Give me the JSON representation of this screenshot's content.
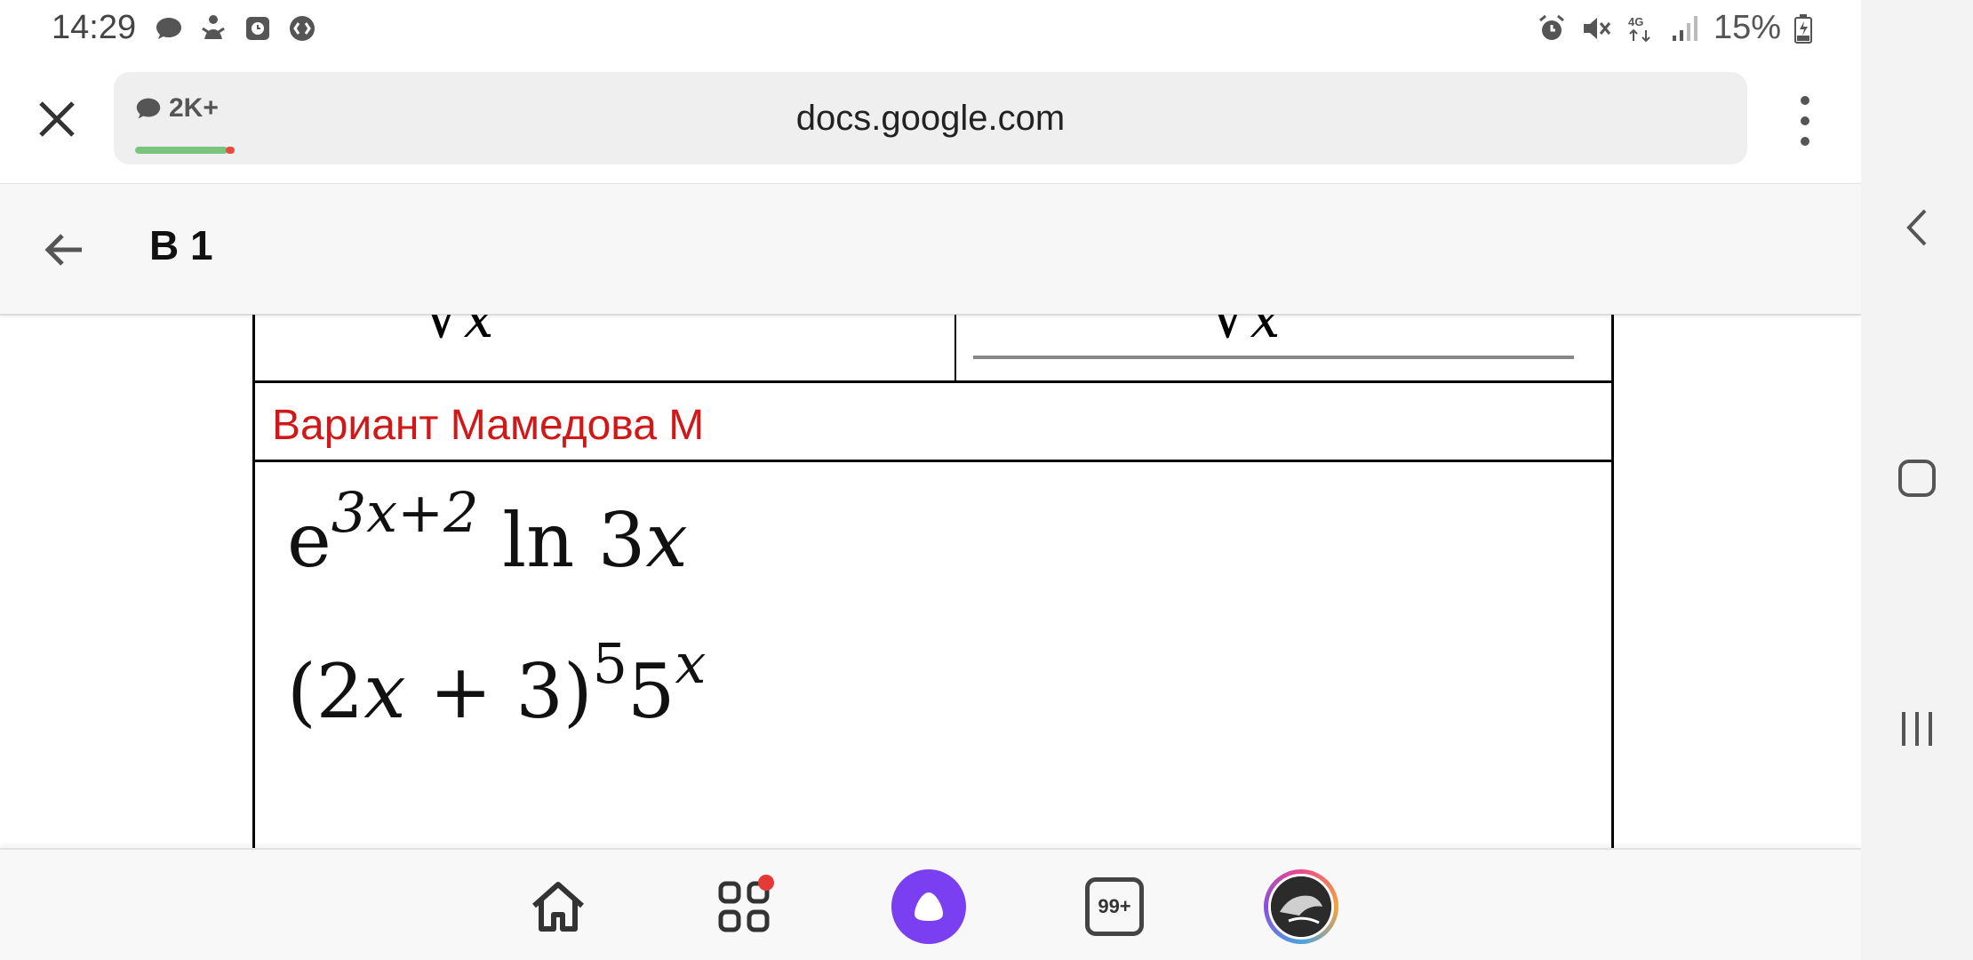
{
  "status_bar": {
    "time": "14:29",
    "battery": "15%",
    "left_icons": [
      "message-icon",
      "person-icon",
      "clock-app-icon",
      "shazam-icon"
    ],
    "right_icons": [
      "alarm-icon",
      "mute-icon",
      "4g-icon",
      "signal-icon",
      "battery-icon"
    ]
  },
  "browser": {
    "url": "docs.google.com",
    "badge_count": "2K+"
  },
  "doc_header": {
    "title": "В 1"
  },
  "document": {
    "variant_label": "Вариант Мамедова М",
    "formula1": {
      "base": "e",
      "exponent": "3x+2",
      "rest": " ln 3",
      "var": "x"
    },
    "formula2": {
      "open": "(2",
      "var1": "x",
      "middle": " + 3)",
      "exp1": "5",
      "base2": "5",
      "exp2": "x"
    }
  },
  "bottom_nav": {
    "count_label": "99+",
    "items": [
      "home-icon",
      "apps-icon",
      "alice-icon",
      "tabs-count-icon",
      "profile-avatar"
    ]
  },
  "colors": {
    "variant_text": "#d01818",
    "alice_purple": "#7b3ff2",
    "badge_green": "#7bc47f",
    "notification_red": "#e53935"
  }
}
